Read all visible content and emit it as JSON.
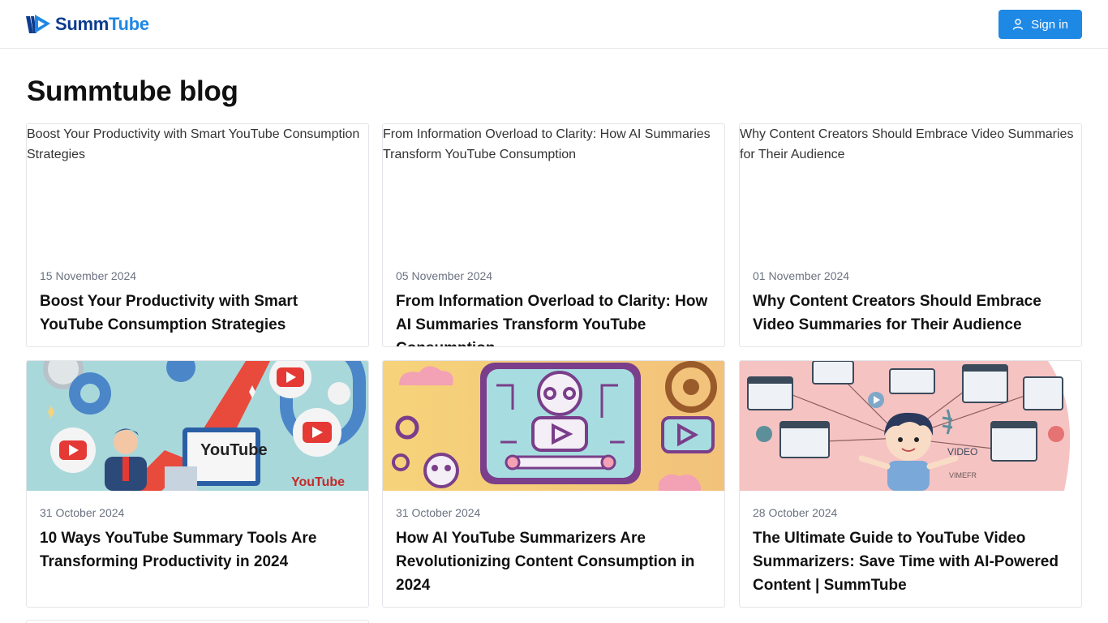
{
  "header": {
    "logo_part1": "Summ",
    "logo_part2": "Tube",
    "signin_label": "Sign in"
  },
  "page": {
    "title": "Summtube blog"
  },
  "posts": [
    {
      "date": "15 November 2024",
      "title": "Boost Your Productivity with Smart YouTube Consumption Strategies",
      "image_alt": "Boost Your Productivity with Smart YouTube Consumption Strategies"
    },
    {
      "date": "05 November 2024",
      "title": "From Information Overload to Clarity: How AI Summaries Transform YouTube Consumption",
      "image_alt": "From Information Overload to Clarity: How AI Summaries Transform YouTube Consumption"
    },
    {
      "date": "01 November 2024",
      "title": "Why Content Creators Should Embrace Video Summaries for Their Audience",
      "image_alt": "Why Content Creators Should Embrace Video Summaries for Their Audience"
    },
    {
      "date": "31 October 2024",
      "title": "10 Ways YouTube Summary Tools Are Transforming Productivity in 2024",
      "image_text_1": "YouTube",
      "image_text_2": "YouTube"
    },
    {
      "date": "31 October 2024",
      "title": "How AI YouTube Summarizers Are Revolutionizing Content Consumption in 2024"
    },
    {
      "date": "28 October 2024",
      "title": "The Ultimate Guide to YouTube Video Summarizers: Save Time with AI-Powered Content | SummTube",
      "image_text_1": "VIDEO",
      "image_text_2": "VIMEFR"
    }
  ],
  "colors": {
    "primary": "#1e88e5",
    "logo_dark": "#0d3b8e",
    "border": "#e3e5e8",
    "muted_text": "#6b7280"
  }
}
